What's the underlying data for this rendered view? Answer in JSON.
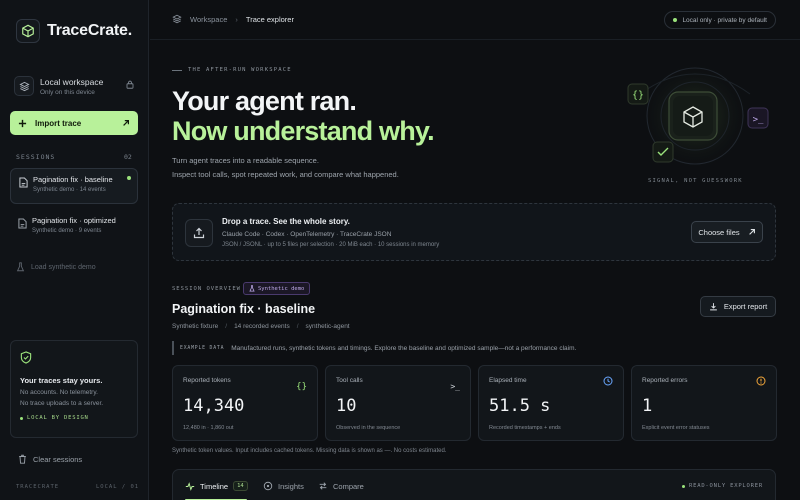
{
  "app": {
    "name": "TraceCrate."
  },
  "sidebar": {
    "workspace_title": "Local workspace",
    "workspace_sub": "Only on this device",
    "import_label": "Import trace",
    "sessions_label": "SESSIONS",
    "sessions_count": "02",
    "sessions": [
      {
        "title": "Pagination fix · baseline",
        "sub": "Synthetic demo · 14 events",
        "active": true
      },
      {
        "title": "Pagination fix · optimized",
        "sub": "Synthetic demo · 9 events",
        "active": false
      }
    ],
    "load_demo": "Load synthetic demo",
    "privacy": {
      "title": "Your traces stay yours.",
      "line1": "No accounts. No telemetry.",
      "line2": "No trace uploads to a server.",
      "tag": "LOCAL BY DESIGN"
    },
    "clear_label": "Clear sessions",
    "footer_left": "TRACECRATE",
    "footer_right": "LOCAL / 01"
  },
  "topbar": {
    "crumb_workspace": "Workspace",
    "crumb_current": "Trace explorer",
    "local_pill": "Local only · private by default"
  },
  "hero": {
    "eyebrow": "THE AFTER-RUN WORKSPACE",
    "title_1": "Your agent ran.",
    "title_2": "Now understand why.",
    "para_1": "Turn agent traces into a readable sequence.",
    "para_2": "Inspect tool calls, spot repeated work, and compare what happened.",
    "signal": "SIGNAL, NOT GUESSWORK"
  },
  "dropzone": {
    "title": "Drop a trace. See the whole story.",
    "formats": "Claude Code · Codex · OpenTelemetry · TraceCrate JSON",
    "limits": "JSON / JSONL · up to 5 files per selection · 20 MiB each · 10 sessions in memory",
    "button": "Choose files"
  },
  "overview": {
    "label": "SESSION OVERVIEW",
    "badge": "Synthetic demo",
    "title": "Pagination fix · baseline",
    "meta": [
      "Synthetic fixture",
      "14 recorded events",
      "synthetic-agent"
    ],
    "export": "Export report",
    "note_tag": "EXAMPLE DATA",
    "note_text": "Manufactured runs, synthetic tokens and timings. Explore the baseline and optimized sample—not a performance claim."
  },
  "metrics": [
    {
      "label": "Reported tokens",
      "value": "14,340",
      "sub": "12,480 in · 1,860 out",
      "icon": "braces-icon",
      "color": "#9be37c"
    },
    {
      "label": "Tool calls",
      "value": "10",
      "sub": "Observed in the sequence",
      "icon": "terminal-icon",
      "color": "#cfd4da"
    },
    {
      "label": "Elapsed time",
      "value": "51.5 s",
      "sub": "Recorded timestamps + ends",
      "icon": "clock-icon",
      "color": "#6aa7ff"
    },
    {
      "label": "Reported errors",
      "value": "1",
      "sub": "Explicit event error statuses",
      "icon": "alert-icon",
      "color": "#f0a53a"
    }
  ],
  "footnote": "Synthetic token values. Input includes cached tokens. Missing data is shown as —. No costs estimated.",
  "tabs": {
    "items": [
      {
        "label": "Timeline",
        "count": "14"
      },
      {
        "label": "Insights"
      },
      {
        "label": "Compare"
      }
    ],
    "readonly": "READ-ONLY EXPLORER"
  },
  "colors": {
    "accent": "#b8f19a",
    "background": "#0d0f12",
    "purple": "#bda9e8"
  }
}
